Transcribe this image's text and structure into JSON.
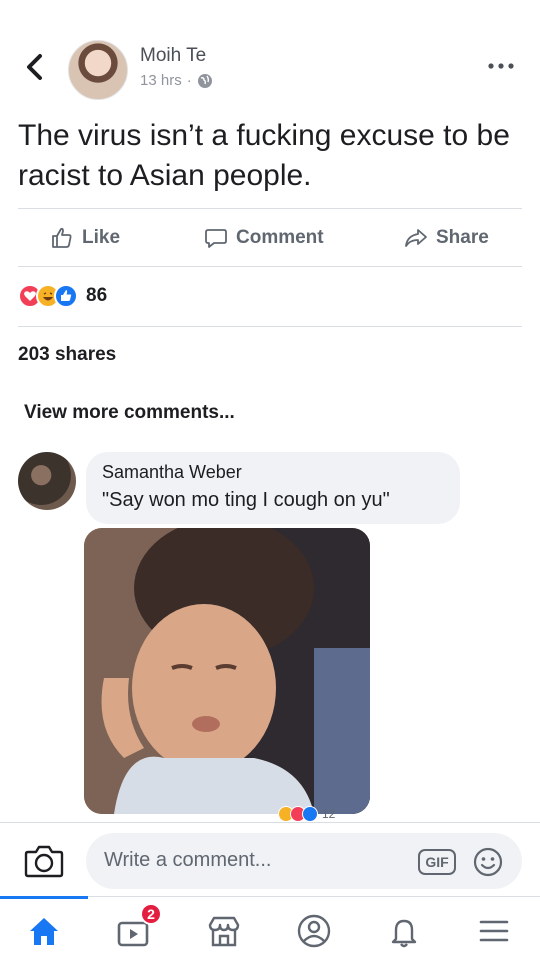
{
  "post": {
    "author": "Moih Te",
    "time": "13 hrs",
    "separator": "·",
    "text": "The virus isn’t a fucking excuse to be racist to Asian people."
  },
  "actions": {
    "like": "Like",
    "comment": "Comment",
    "share": "Share"
  },
  "reactions": {
    "types": [
      "love-reaction",
      "haha-reaction",
      "like-reaction"
    ],
    "count": "86"
  },
  "shares": "203 shares",
  "view_more": "View more comments...",
  "comment": {
    "author": "Samantha Weber",
    "text": "\"Say won mo ting I cough on yu\"",
    "reaction_count": "12"
  },
  "composer": {
    "placeholder": "Write a comment...",
    "gif_label": "GIF"
  },
  "tabbar": {
    "items": [
      "home-icon",
      "video-icon",
      "marketplace-icon",
      "profile-icon",
      "notifications-icon",
      "menu-icon"
    ],
    "video_badge": "2"
  },
  "colors": {
    "accent": "#1877f2",
    "badge": "#e41e3f",
    "bubble": "#f0f2f5"
  }
}
